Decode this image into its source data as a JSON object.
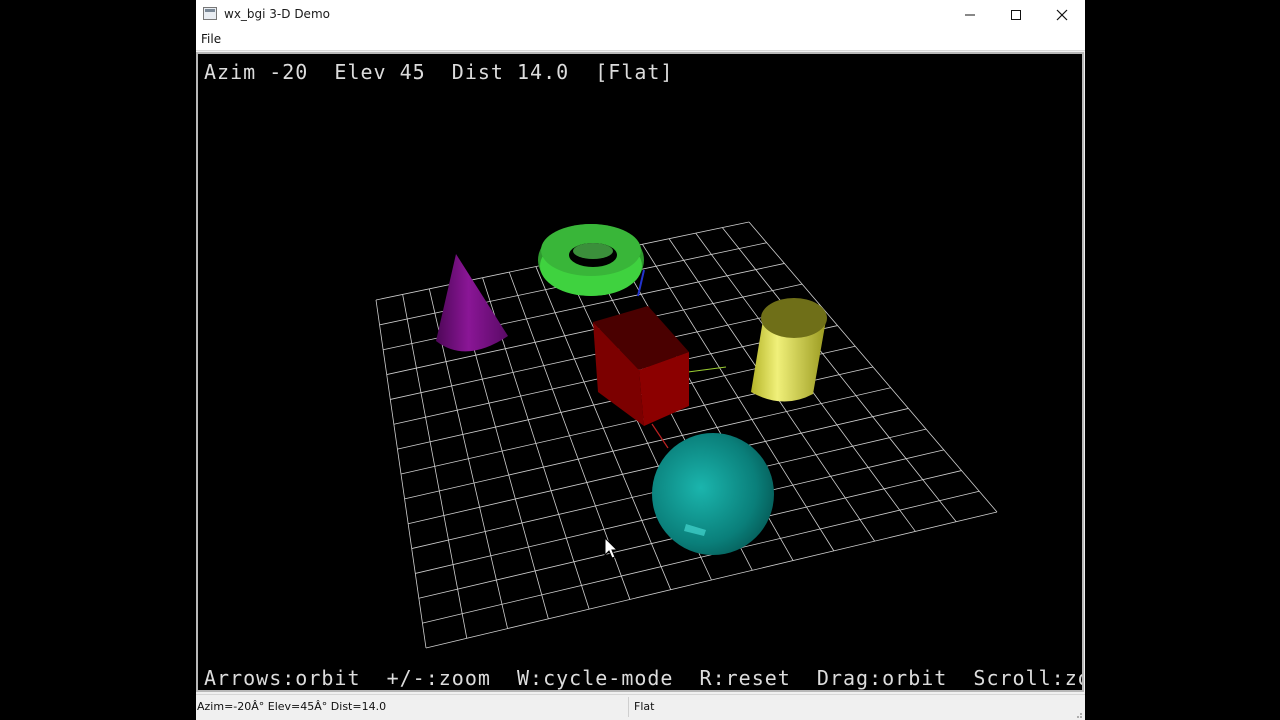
{
  "window": {
    "title": "wx_bgi 3-D Demo",
    "minimize_icon": "minimize-icon",
    "maximize_icon": "maximize-icon",
    "close_icon": "close-icon"
  },
  "menu": {
    "file": "File"
  },
  "viewport": {
    "header": "Azim -20  Elev 45  Dist 14.0  [Flat]",
    "footer": "Arrows:orbit  +/-:zoom  W:cycle-mode  R:reset  Drag:orbit  Scroll:zoom",
    "background": "#000000",
    "grid_color": "#cfcfcf",
    "objects": [
      {
        "name": "cone",
        "color": "#7a0f86"
      },
      {
        "name": "torus",
        "color": "#2fb52f"
      },
      {
        "name": "cube",
        "color": "#7a0000"
      },
      {
        "name": "cylinder",
        "color": "#c9c93a"
      },
      {
        "name": "sphere",
        "color": "#0e8f8a"
      }
    ]
  },
  "status": {
    "left": "Azim=-20Â° Elev=45Â° Dist=14.0",
    "right": "Flat"
  }
}
